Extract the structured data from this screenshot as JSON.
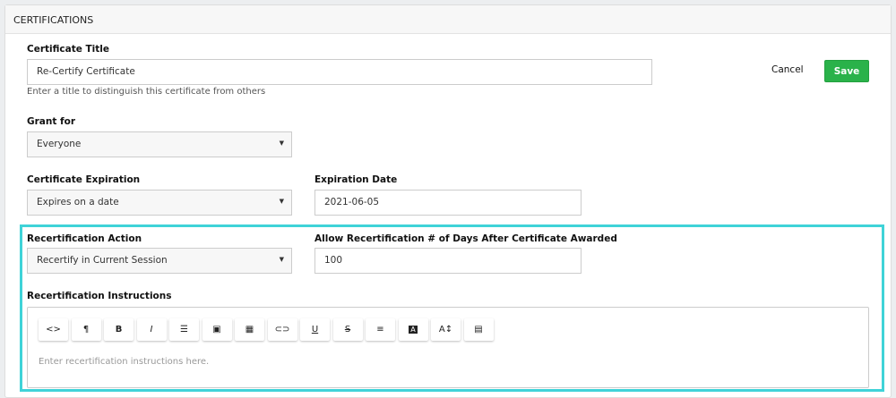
{
  "header": {
    "title": "CERTIFICATIONS"
  },
  "title_field": {
    "label": "Certificate Title",
    "value": "Re-Certify Certificate",
    "help": "Enter a title to distinguish this certificate from others"
  },
  "actions": {
    "cancel": "Cancel",
    "save": "Save"
  },
  "grant_for": {
    "label": "Grant for",
    "value": "Everyone"
  },
  "expiration": {
    "label": "Certificate Expiration",
    "value": "Expires on a date"
  },
  "expiration_date": {
    "label": "Expiration Date",
    "value": "2021-06-05"
  },
  "recert_action": {
    "label": "Recertification Action",
    "value": "Recertify in Current Session"
  },
  "recert_days": {
    "label": "Allow Recertification # of Days After Certificate Awarded",
    "value": "100"
  },
  "instructions": {
    "label": "Recertification Instructions",
    "placeholder": "Enter recertification instructions here."
  },
  "toolbar": [
    {
      "icon": "code-view-icon",
      "glyph": "<>"
    },
    {
      "icon": "paragraph-icon",
      "glyph": "¶"
    },
    {
      "icon": "bold-icon",
      "glyph": "B"
    },
    {
      "icon": "italic-icon",
      "glyph": "I"
    },
    {
      "icon": "list-icon",
      "glyph": "☰"
    },
    {
      "icon": "image-icon",
      "glyph": "▣"
    },
    {
      "icon": "table-icon",
      "glyph": "▦"
    },
    {
      "icon": "link-icon",
      "glyph": "⊂⊃"
    },
    {
      "icon": "underline-icon",
      "glyph": "U"
    },
    {
      "icon": "strikethrough-icon",
      "glyph": "S"
    },
    {
      "icon": "align-icon",
      "glyph": "≡"
    },
    {
      "icon": "text-color-icon",
      "glyph": "A"
    },
    {
      "icon": "font-size-icon",
      "glyph": "A↕"
    },
    {
      "icon": "html-source-icon",
      "glyph": "▤"
    }
  ],
  "colors": {
    "accent": "#3fd3d8",
    "save": "#2ab24a"
  }
}
